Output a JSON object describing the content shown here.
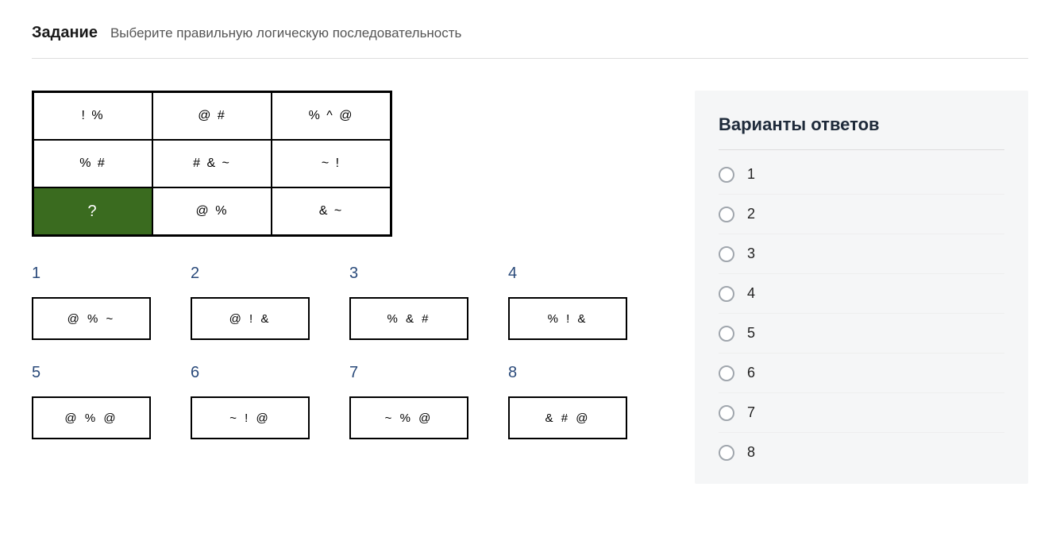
{
  "header": {
    "title": "Задание",
    "subtitle": "Выберите правильную логическую последовательность"
  },
  "grid": [
    {
      "val": "! %",
      "highlight": false
    },
    {
      "val": "@ #",
      "highlight": false
    },
    {
      "val": "% ^ @",
      "highlight": false
    },
    {
      "val": "% #",
      "highlight": false
    },
    {
      "val": "# & ~",
      "highlight": false
    },
    {
      "val": "~ !",
      "highlight": false
    },
    {
      "val": "?",
      "highlight": true
    },
    {
      "val": "@ %",
      "highlight": false
    },
    {
      "val": "& ~",
      "highlight": false
    }
  ],
  "options": [
    {
      "num": "1",
      "val": "@ % ~"
    },
    {
      "num": "2",
      "val": "@ ! &"
    },
    {
      "num": "3",
      "val": "% & #"
    },
    {
      "num": "4",
      "val": "% ! &"
    },
    {
      "num": "5",
      "val": "@ % @"
    },
    {
      "num": "6",
      "val": "~ ! @"
    },
    {
      "num": "7",
      "val": "~ % @"
    },
    {
      "num": "8",
      "val": "& # @"
    }
  ],
  "answers": {
    "title": "Варианты ответов",
    "items": [
      {
        "label": "1"
      },
      {
        "label": "2"
      },
      {
        "label": "3"
      },
      {
        "label": "4"
      },
      {
        "label": "5"
      },
      {
        "label": "6"
      },
      {
        "label": "7"
      },
      {
        "label": "8"
      }
    ]
  }
}
